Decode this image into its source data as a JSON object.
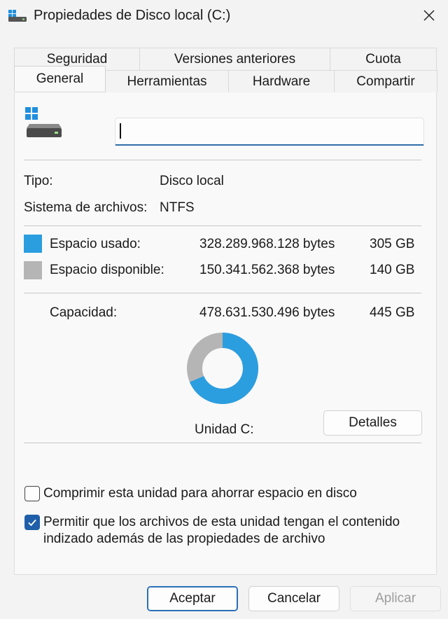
{
  "window": {
    "title": "Propiedades de Disco local (C:)"
  },
  "tabs": {
    "back": [
      "Seguridad",
      "Versiones anteriores",
      "Cuota"
    ],
    "front": [
      "General",
      "Herramientas",
      "Hardware",
      "Compartir"
    ],
    "active": "General"
  },
  "drive": {
    "name_value": "",
    "type_label": "Tipo:",
    "type_value": "Disco local",
    "fs_label": "Sistema de archivos:",
    "fs_value": "NTFS"
  },
  "space": {
    "used_label": "Espacio usado:",
    "used_bytes": "328.289.968.128 bytes",
    "used_gb": "305 GB",
    "free_label": "Espacio disponible:",
    "free_bytes": "150.341.562.368 bytes",
    "free_gb": "140 GB",
    "capacity_label": "Capacidad:",
    "capacity_bytes": "478.631.530.496 bytes",
    "capacity_gb": "445 GB",
    "used_fraction": 0.686,
    "used_color": "#2b9ee0",
    "free_color": "#b5b5b5"
  },
  "unit_label": "Unidad C:",
  "details_button": "Detalles",
  "options": {
    "compress_label": "Comprimir esta unidad para ahorrar espacio en disco",
    "compress_checked": false,
    "index_label_line1": "Permitir que los archivos de esta unidad tengan el contenido",
    "index_label_line2": "indizado además de las propiedades de archivo",
    "index_checked": true
  },
  "buttons": {
    "ok": "Aceptar",
    "cancel": "Cancelar",
    "apply": "Aplicar"
  },
  "colors": {
    "accent": "#2b6fb8",
    "checkbox_checked": "#1f5fa9"
  }
}
